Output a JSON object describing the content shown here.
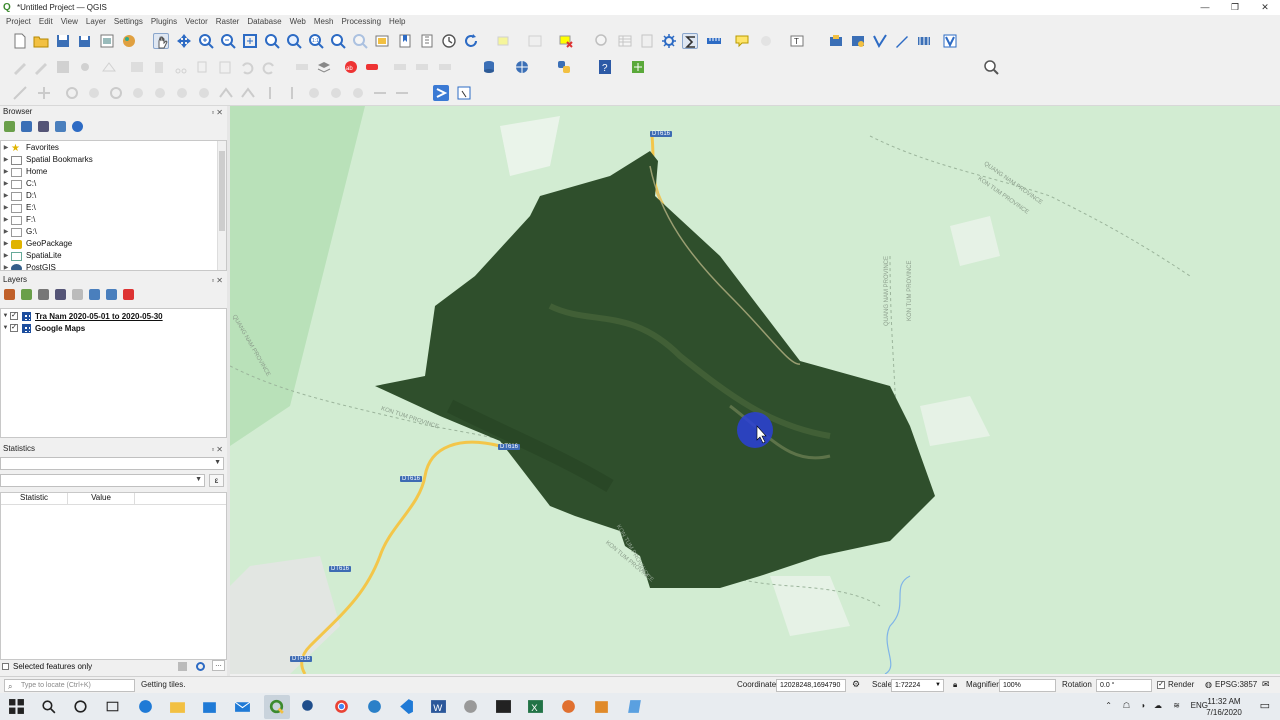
{
  "window": {
    "title": "*Untitled Project — QGIS",
    "controls": [
      "—",
      "❐",
      "✕"
    ]
  },
  "menu": [
    "Project",
    "Edit",
    "View",
    "Layer",
    "Settings",
    "Plugins",
    "Vector",
    "Raster",
    "Database",
    "Web",
    "Mesh",
    "Processing",
    "Help"
  ],
  "browser": {
    "title": "Browser",
    "items": [
      {
        "label": "Favorites",
        "icon": "star-icon"
      },
      {
        "label": "Spatial Bookmarks",
        "icon": "bookmark-icon"
      },
      {
        "label": "Home",
        "icon": "folder-icon"
      },
      {
        "label": "C:\\",
        "icon": "folder-icon"
      },
      {
        "label": "D:\\",
        "icon": "folder-icon"
      },
      {
        "label": "E:\\",
        "icon": "folder-icon"
      },
      {
        "label": "F:\\",
        "icon": "folder-icon"
      },
      {
        "label": "G:\\",
        "icon": "folder-icon"
      },
      {
        "label": "GeoPackage",
        "icon": "geopackage-icon"
      },
      {
        "label": "SpatiaLite",
        "icon": "spatialite-icon"
      },
      {
        "label": "PostGIS",
        "icon": "postgis-icon"
      }
    ]
  },
  "layers": {
    "title": "Layers",
    "items": [
      {
        "label": "Tra Nam 2020-05-01 to 2020-05-30",
        "checked": true,
        "underlined": true
      },
      {
        "label": "Google Maps",
        "checked": true,
        "underlined": false
      }
    ]
  },
  "statistics": {
    "title": "Statistics",
    "columns": [
      "Statistic",
      "Value"
    ],
    "selected_only_label": "Selected features only",
    "sigma_label": "Σ"
  },
  "map": {
    "road_labels": [
      "DT616",
      "DT616",
      "DT616",
      "DT616",
      "DT616"
    ],
    "province_labels": [
      "QUANG NAM PROVINCE",
      "KON TUM PROVINCE",
      "QUANG NAM PROVINCE",
      "KON TUM PROVINCE",
      "KON TUM PROVINCE",
      "QUANG NAM PROVINCE",
      "KON TUM PROVINCE",
      "KON TUM PROVINCE"
    ],
    "colors": {
      "base": "#d2ecd2",
      "forest": "#2f4f2c",
      "road": "#f3c64a",
      "cursor": "#2a3fd8"
    }
  },
  "status": {
    "locate_placeholder": "Type to locate (Ctrl+K)",
    "message": "Getting tiles.",
    "coordinate_label": "Coordinate",
    "coordinate_value": "12028248,1694790",
    "scale_label": "Scale",
    "scale_value": "1:72224",
    "magnifier_label": "Magnifier",
    "magnifier_value": "100%",
    "rotation_label": "Rotation",
    "rotation_value": "0.0 °",
    "render_label": "Render",
    "crs": "EPSG:3857"
  },
  "taskbar": {
    "time": "11:32 AM",
    "date": "7/16/2020",
    "lang": "ENG"
  }
}
